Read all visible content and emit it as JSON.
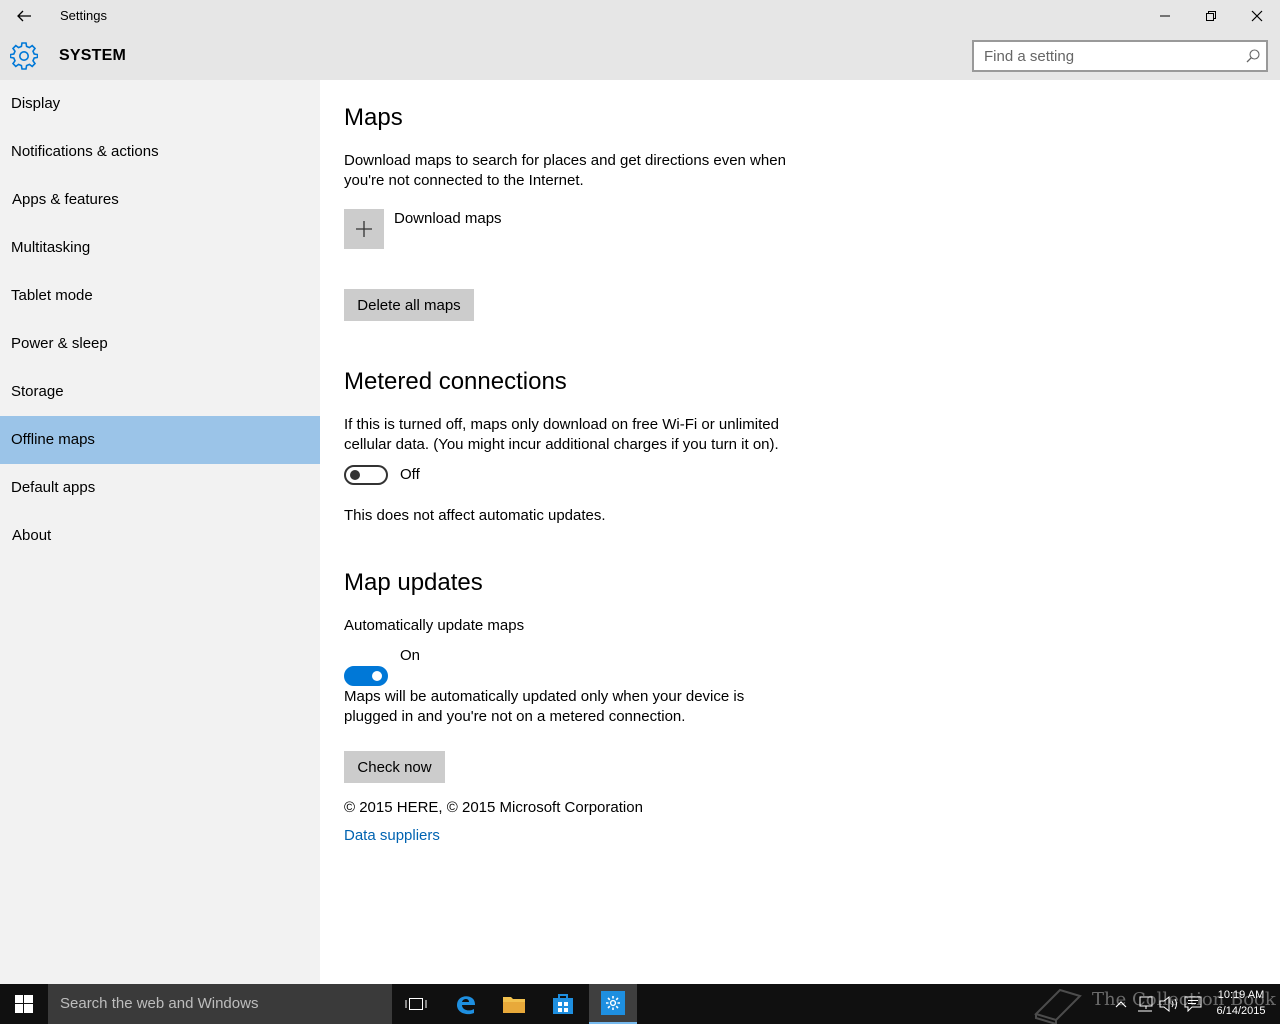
{
  "window": {
    "title": "Settings",
    "back_icon": "back-arrow-icon",
    "controls": [
      "minimize-icon",
      "restore-icon",
      "close-icon"
    ]
  },
  "header": {
    "section": "SYSTEM",
    "icon": "gear-icon",
    "search_placeholder": "Find a setting",
    "accent": "#0078d7"
  },
  "sidebar": {
    "items": [
      {
        "label": "Display"
      },
      {
        "label": "Notifications & actions"
      },
      {
        "label": "Apps & features"
      },
      {
        "label": "Multitasking"
      },
      {
        "label": "Tablet mode"
      },
      {
        "label": "Power & sleep"
      },
      {
        "label": "Storage"
      },
      {
        "label": "Offline maps",
        "active": true
      },
      {
        "label": "Default apps"
      },
      {
        "label": "About"
      }
    ],
    "active_color": "#9bc4e8"
  },
  "main": {
    "maps": {
      "heading": "Maps",
      "description": "Download maps to search for places and get directions even when you're not connected to the Internet.",
      "download_label": "Download maps",
      "delete_label": "Delete all maps"
    },
    "metered": {
      "heading": "Metered connections",
      "description": "If this is turned off, maps only download on free Wi-Fi or unlimited cellular data. (You might incur additional charges if you turn it on).",
      "toggle_state": "Off",
      "note": "This does not affect automatic updates."
    },
    "updates": {
      "heading": "Map updates",
      "auto_label": "Automatically update maps",
      "toggle_state": "On",
      "description": "Maps will be automatically updated only when your device is plugged in and you're not on a metered connection.",
      "check_label": "Check now"
    },
    "copyright": "© 2015 HERE, © 2015 Microsoft Corporation",
    "data_suppliers": "Data suppliers"
  },
  "taskbar": {
    "search_placeholder": "Search the web and Windows",
    "pinned": [
      "task-view-icon",
      "edge-icon",
      "file-explorer-icon",
      "store-icon",
      "settings-icon"
    ],
    "time": "10:19 AM",
    "date": "6/14/2015",
    "watermark": "The Collection Book"
  }
}
